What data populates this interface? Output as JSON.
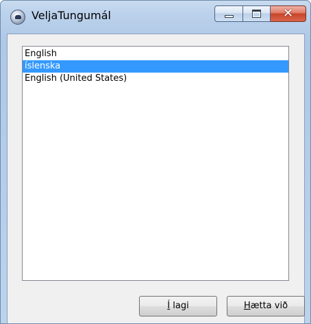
{
  "window": {
    "title": "VeljaTungumál",
    "icon": "telephone-icon"
  },
  "caption": {
    "minimize_icon": "minimize-icon",
    "maximize_icon": "maximize-icon",
    "close_icon": "close-icon",
    "close_glyph": "✕"
  },
  "languages": {
    "items": [
      {
        "label": "English",
        "selected": false
      },
      {
        "label": "íslenska",
        "selected": true
      },
      {
        "label": "English (United States)",
        "selected": false
      }
    ]
  },
  "buttons": {
    "ok": {
      "mnemonic": "Í",
      "rest": " lagi"
    },
    "cancel": {
      "mnemonic": "H",
      "rest": "ætta við"
    }
  },
  "colors": {
    "selection": "#3399ff",
    "close_button": "#c8452c"
  }
}
